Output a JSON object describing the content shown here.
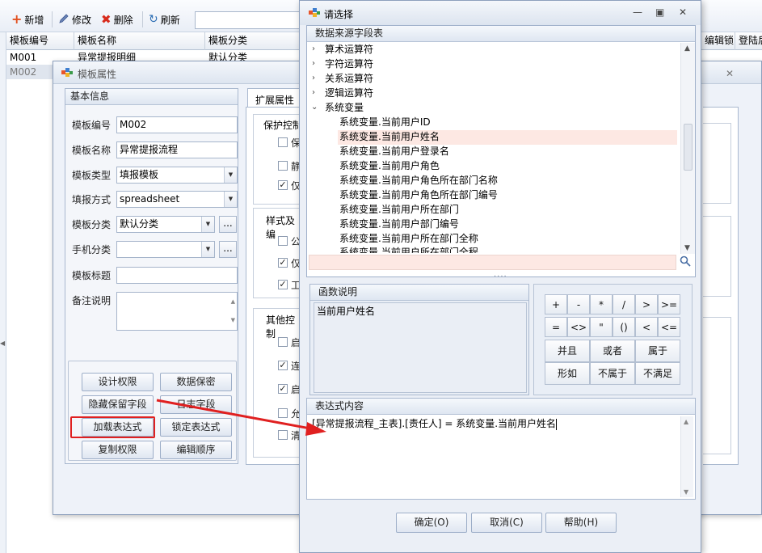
{
  "toolbar": {
    "add_label": "新增",
    "edit_label": "修改",
    "delete_label": "删除",
    "refresh_label": "刷新"
  },
  "grid": {
    "columns": [
      "模板编号",
      "模板名称",
      "模板分类",
      "编辑锁",
      "登陆后"
    ],
    "rows": [
      {
        "code": "M001",
        "name": "异常提报明细",
        "category": "默认分类"
      },
      {
        "code": "M002",
        "name": "",
        "category": ""
      }
    ]
  },
  "template_dialog": {
    "title": "模板属性",
    "basic_info": {
      "header": "基本信息",
      "fields": {
        "code_label": "模板编号",
        "code_value": "M002",
        "name_label": "模板名称",
        "name_value": "异常提报流程",
        "type_label": "模板类型",
        "type_value": "填报模板",
        "fill_label": "填报方式",
        "fill_value": "spreadsheet",
        "category_label": "模板分类",
        "category_value": "默认分类",
        "mobile_label": "手机分类",
        "mobile_value": "",
        "title_label": "模板标题",
        "title_value": "",
        "remark_label": "备注说明",
        "remark_value": ""
      },
      "dots": "..."
    },
    "buttons": {
      "design_perm": "设计权限",
      "data_secret": "数据保密",
      "hide_fields": "隐藏保留字段",
      "log_fields": "日志字段",
      "load_expr": "加载表达式",
      "lock_expr": "锁定表达式",
      "copy_perm": "复制权限",
      "edit_order": "编辑顺序"
    },
    "ext": {
      "tab_label": "扩展属性",
      "group_protect": "保护控制",
      "group_style": "样式及编",
      "group_other": "其他控制",
      "chk_labels": [
        "保",
        "静",
        "仅",
        "公",
        "仅",
        "工",
        "启",
        "连",
        "启",
        "允",
        "清"
      ]
    }
  },
  "select_dialog": {
    "title": "请选择",
    "tree_header": "数据来源字段表",
    "groups": [
      "算术运算符",
      "字符运算符",
      "关系运算符",
      "逻辑运算符",
      "系统变量"
    ],
    "sys_vars": [
      "系统变量.当前用户ID",
      "系统变量.当前用户姓名",
      "系统变量.当前用户登录名",
      "系统变量.当前用户角色",
      "系统变量.当前用户角色所在部门名称",
      "系统变量.当前用户角色所在部门编号",
      "系统变量.当前用户所在部门",
      "系统变量.当前用户部门编号",
      "系统变量.当前用户所在部门全称",
      "系统变量.当前用户所在部门全程"
    ],
    "func_header": "函数说明",
    "func_desc": "当前用户姓名",
    "operators": [
      "+",
      "-",
      "*",
      "/",
      ">",
      ">=",
      "=",
      "<>",
      "\"",
      "()",
      "<",
      "<="
    ],
    "word_ops": [
      "并且",
      "或者",
      "属于",
      "形如",
      "不属于",
      "不满足"
    ],
    "expr_header": "表达式内容",
    "expr_content": "[异常提报流程_主表].[责任人] = 系统变量.当前用户姓名",
    "ok_label": "确定(O)",
    "cancel_label": "取消(C)",
    "help_label": "帮助(H)",
    "splitter": "....",
    "colors": {
      "highlight": "#fde8e3",
      "annotation": "#e02020"
    }
  }
}
